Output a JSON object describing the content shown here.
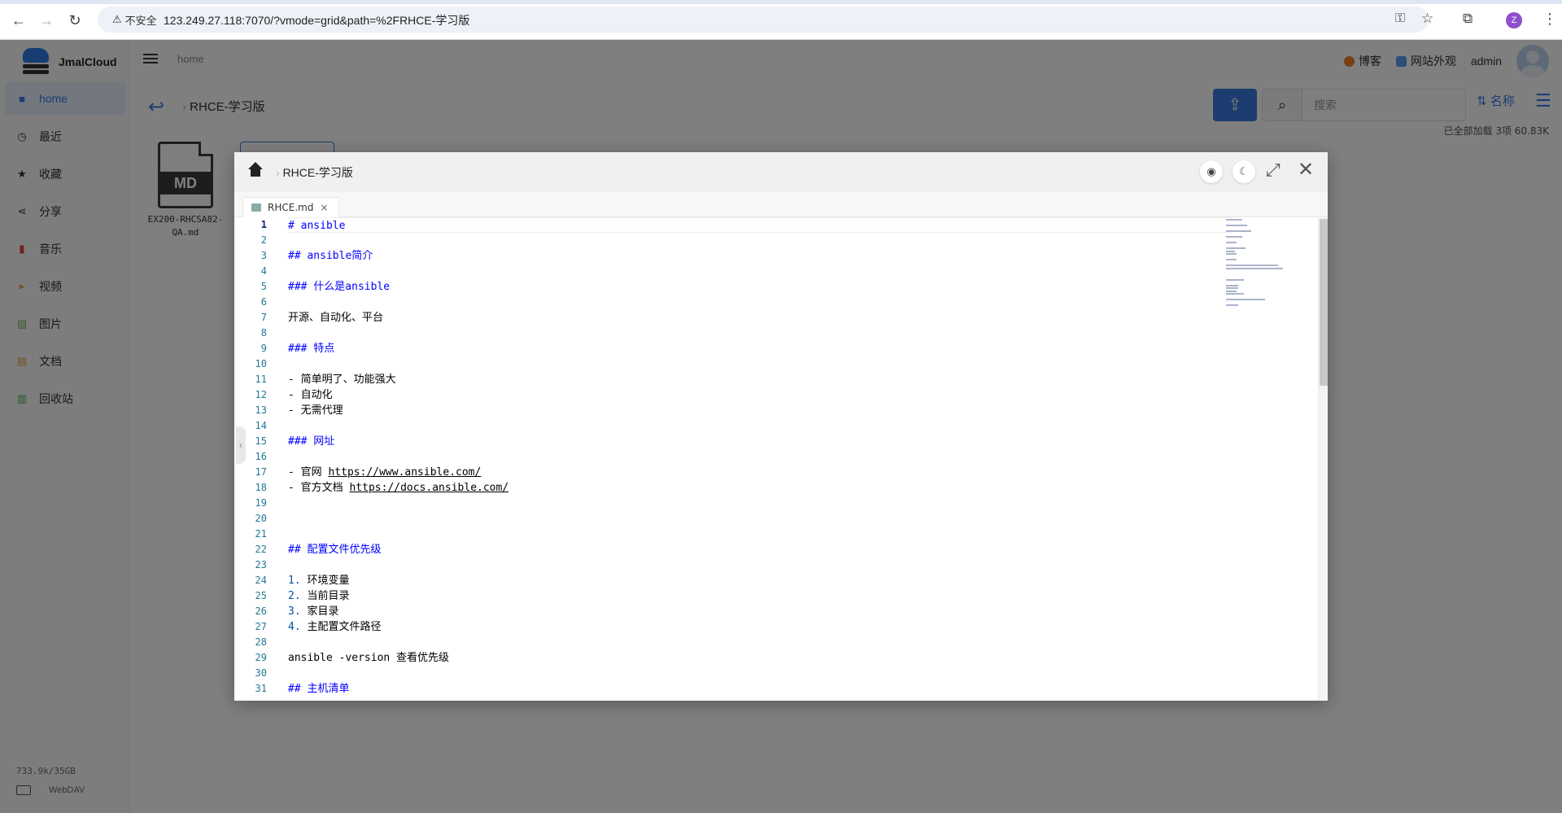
{
  "browser": {
    "security_label": "不安全",
    "url": "123.249.27.118:7070/?vmode=grid&path=%2FRHCE-学习版",
    "profile_initial": "Z",
    "icons": [
      "back-icon",
      "forward-icon",
      "reload-icon",
      "key-icon",
      "star-icon",
      "extensions-icon"
    ]
  },
  "app": {
    "brand": "JmalCloud",
    "sidebar": {
      "items": [
        {
          "label": "home",
          "icon": "folder-icon",
          "color": "#3b7be0"
        },
        {
          "label": "最近",
          "icon": "clock-icon",
          "color": "#555555"
        },
        {
          "label": "收藏",
          "icon": "star-icon",
          "color": "#333333"
        },
        {
          "label": "分享",
          "icon": "share-icon",
          "color": "#333333"
        },
        {
          "label": "音乐",
          "icon": "music-icon",
          "color": "#e03c3c"
        },
        {
          "label": "视频",
          "icon": "video-icon",
          "color": "#f0a040"
        },
        {
          "label": "图片",
          "icon": "image-icon",
          "color": "#7ab55c"
        },
        {
          "label": "文档",
          "icon": "document-icon",
          "color": "#f0a040"
        },
        {
          "label": "回收站",
          "icon": "trash-icon",
          "color": "#4caf50"
        }
      ],
      "storage": "733.9k/35GB",
      "webdav": "WebDAV"
    },
    "topbar": {
      "breadcrumb": "home",
      "blog": "博客",
      "appearance": "网站外观",
      "user": "admin"
    },
    "toolbar": {
      "path": "RHCE-学习版",
      "search_placeholder": "搜索",
      "sort_label": "名称",
      "load_status": "已全部加载 3项 60.83K"
    },
    "files": [
      {
        "name": "EX200-RHCSA82-QA.md",
        "badge": "MD"
      }
    ]
  },
  "dialog": {
    "breadcrumb": "RHCE-学习版",
    "tab_name": "RHCE.md",
    "lines": [
      "# ansible",
      "",
      "## ansible简介",
      "",
      "### 什么是ansible",
      "",
      "开源、自动化、平台",
      "",
      "### 特点",
      "",
      "- 简单明了、功能强大",
      "- 自动化",
      "- 无需代理",
      "",
      "### 网址",
      "",
      "- 官网 https://www.ansible.com/",
      "- 官方文档 https://docs.ansible.com/",
      "",
      "",
      "",
      "## 配置文件优先级",
      "",
      "1. 环境变量",
      "2. 当前目录",
      "3. 家目录",
      "4. 主配置文件路径",
      "",
      "ansible -version 查看优先级",
      "",
      "## 主机清单"
    ],
    "heading_lines": [
      1,
      3,
      5,
      9,
      15,
      22,
      31
    ],
    "current_line": 1
  },
  "colors": {
    "accent": "#3b7be0",
    "heading": "#0000ff",
    "line_number": "#237893"
  }
}
